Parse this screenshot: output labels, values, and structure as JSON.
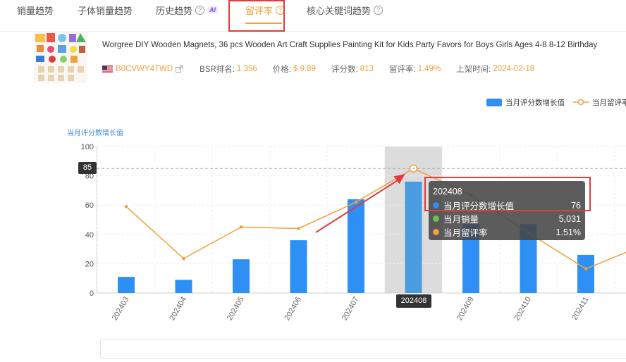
{
  "tabs": [
    {
      "label": "销量趋势",
      "help": false,
      "ai": false
    },
    {
      "label": "子体销量趋势",
      "help": false,
      "ai": false
    },
    {
      "label": "历史趋势",
      "help": true,
      "ai": true
    },
    {
      "label": "留评率",
      "help": true,
      "ai": false,
      "active": true
    },
    {
      "label": "核心关键词趋势",
      "help": true,
      "ai": false
    }
  ],
  "ai_badge": "AI",
  "help_glyph": "?",
  "product": {
    "title": "Worgree DIY Wooden Magnets, 36 pcs Wooden Art Craft Supplies Painting Kit for Kids Party Favors for Boys Girls Ages 4-8 8-12 Birthday",
    "asin": "B0CVWY4TWD",
    "bsr_label": "BSR排名:",
    "bsr_value": "1,356",
    "price_label": "价格:",
    "price_value": "$ 9.89",
    "ratings_label": "评分数:",
    "ratings_value": "813",
    "review_rate_label": "留评率:",
    "review_rate_value": "1.49%",
    "launch_label": "上架时间:",
    "launch_value": "2024-02-18"
  },
  "colors": {
    "bar": "#2e8ff5",
    "bar_hover": "#4a9be0",
    "line": "#f0a03c",
    "sales_dot": "#6cc04a",
    "highlight": "#e23b3b"
  },
  "chart_data": {
    "type": "bar",
    "categories": [
      "202403",
      "202404",
      "202405",
      "202406",
      "202407",
      "202408",
      "202409",
      "202410",
      "202411"
    ],
    "series": [
      {
        "name": "当月评分数增长值",
        "type": "bar",
        "values": [
          11,
          9,
          23,
          36,
          64,
          76,
          47,
          47,
          26
        ]
      },
      {
        "name": "当月留评率",
        "type": "line",
        "values": [
          59,
          23.5,
          45,
          44,
          62,
          85,
          67,
          41,
          16.5
        ]
      }
    ],
    "ylabel": "当月评分数增长值",
    "ylim": [
      0,
      100
    ],
    "yticks": [
      0,
      20,
      40,
      60,
      80,
      100
    ],
    "grid": true,
    "legend": "top-right",
    "crosshair_value": "85",
    "hover_category": "202408",
    "tooltip": {
      "title": "202408",
      "rows": [
        {
          "name": "当月评分数增长值",
          "value": "76"
        },
        {
          "name": "当月销量",
          "value": "5,031"
        },
        {
          "name": "当月留评率",
          "value": "1.51%"
        }
      ]
    }
  }
}
